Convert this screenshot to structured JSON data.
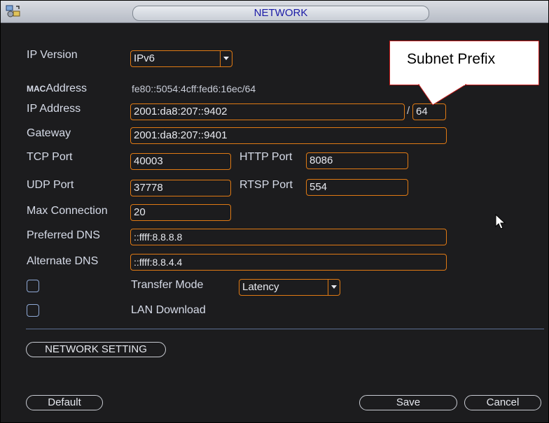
{
  "window": {
    "title": "NETWORK",
    "title_icon": "network-settings-icon"
  },
  "callout": {
    "text": "Subnet Prefix"
  },
  "fields": {
    "ip_version": {
      "label": "IP Version",
      "value": "IPv6"
    },
    "mac_address": {
      "label_prefix": "MAC",
      "label": "Address",
      "value": "fe80::5054:4cff:fed6:16ec/64"
    },
    "ip_address": {
      "label": "IP Address",
      "value": "2001:da8:207::9402",
      "separator": "/",
      "prefix_value": "64"
    },
    "gateway": {
      "label": "Gateway",
      "value": "2001:da8:207::9401"
    },
    "tcp_port": {
      "label": "TCP Port",
      "value": "40003"
    },
    "http_port": {
      "label": "HTTP Port",
      "value": "8086"
    },
    "udp_port": {
      "label": "UDP Port",
      "value": "37778"
    },
    "rtsp_port": {
      "label": "RTSP Port",
      "value": "554"
    },
    "max_connection": {
      "label": "Max Connection",
      "value": "20"
    },
    "preferred_dns": {
      "label": "Preferred DNS",
      "value": "::ffff:8.8.8.8"
    },
    "alternate_dns": {
      "label": "Alternate DNS",
      "value": "::ffff:8.8.4.4"
    },
    "transfer_mode": {
      "label": "Transfer Mode",
      "value": "Latency",
      "checked": false
    },
    "lan_download": {
      "label": "LAN Download",
      "checked": false
    }
  },
  "buttons": {
    "network_setting": "NETWORK SETTING",
    "default": "Default",
    "save": "Save",
    "cancel": "Cancel"
  },
  "colors": {
    "background": "#1c1c1e",
    "field_border": "#e07a14",
    "title_text": "#1a1aa6",
    "callout_border": "#c01818"
  }
}
